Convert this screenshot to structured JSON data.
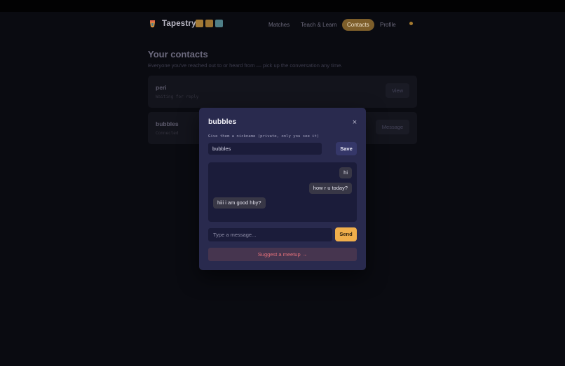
{
  "app": {
    "brand": "Tapestry"
  },
  "nav": {
    "items": [
      {
        "label": "Matches",
        "active": false
      },
      {
        "label": "Teach & Learn",
        "active": false
      },
      {
        "label": "Contacts",
        "active": true
      },
      {
        "label": "Profile",
        "active": false
      }
    ]
  },
  "theme_swatches": [
    "#a47a35",
    "#9c7433",
    "#4f7f88"
  ],
  "page": {
    "title": "Your contacts",
    "subtitle": "Everyone you've reached out to or heard from — pick up the conversation any time."
  },
  "contacts": [
    {
      "name": "peri",
      "status": "Waiting for reply",
      "action": "View"
    },
    {
      "name": "bubbles",
      "status": "Connected",
      "action": "Message"
    }
  ],
  "modal": {
    "title": "bubbles",
    "close_icon": "×",
    "nickname_label": "Give them a nickname (private, only you see it)",
    "nickname_value": "bubbles",
    "save_label": "Save",
    "messages": [
      {
        "text": "hi",
        "from": "me"
      },
      {
        "text": "how r u today?",
        "from": "me"
      },
      {
        "text": "hiii i am good hby?",
        "from": "them"
      }
    ],
    "message_placeholder": "Type a message...",
    "send_label": "Send",
    "meetup_label": "Suggest a meetup →"
  },
  "colors": {
    "accent": "#f0ae4b",
    "modal_bg": "#292a4e",
    "meetup_text": "#e2707a"
  }
}
